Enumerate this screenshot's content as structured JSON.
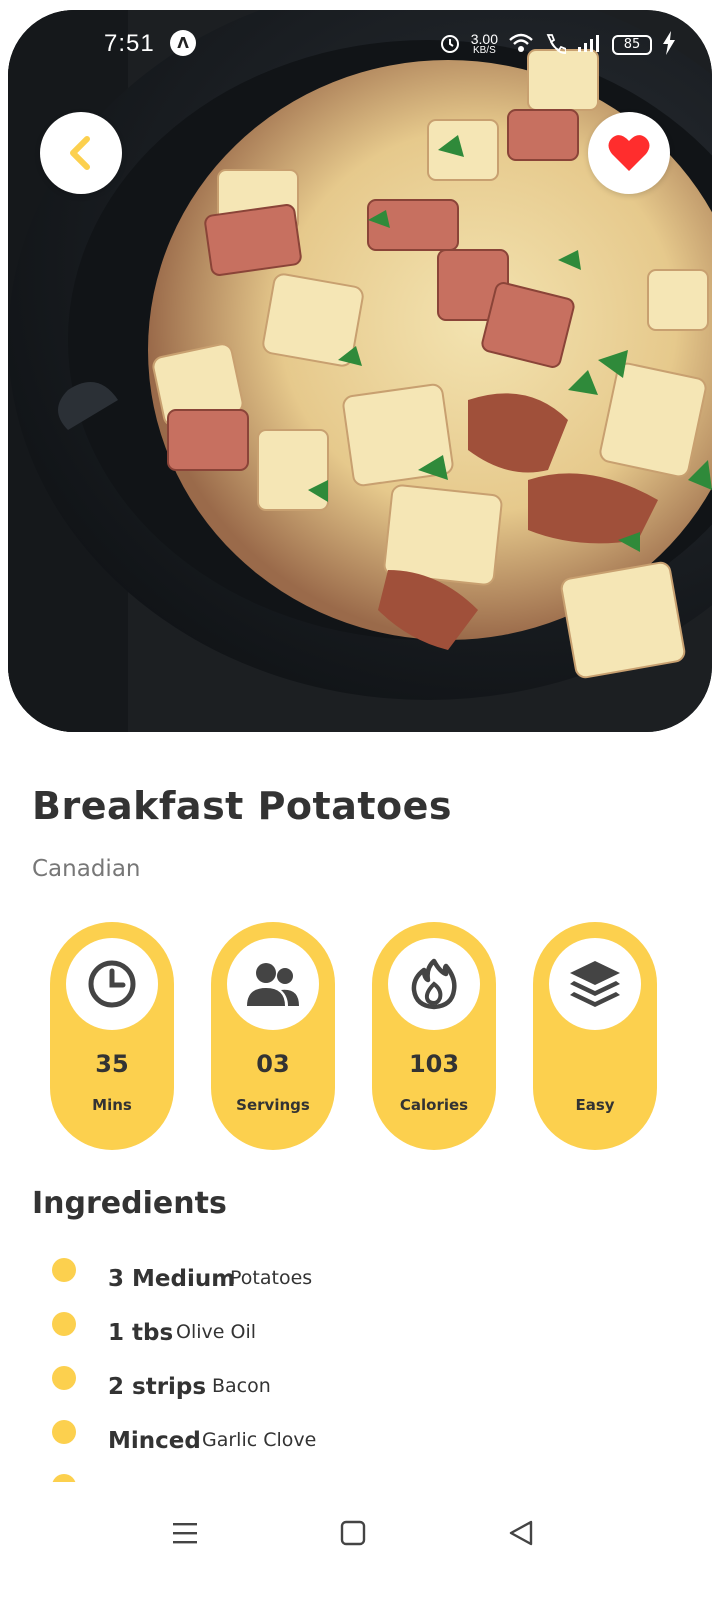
{
  "status_bar": {
    "time": "7:51",
    "speed_value": "3.00",
    "speed_unit": "KB/S",
    "battery": "85"
  },
  "recipe": {
    "title": "Breakfast Potatoes",
    "cuisine": "Canadian",
    "favorite_color": "#ff2d2d",
    "accent_color": "#fcd04e"
  },
  "stats": [
    {
      "icon": "clock-icon",
      "value": "35",
      "label": "Mins"
    },
    {
      "icon": "people-icon",
      "value": "03",
      "label": "Servings"
    },
    {
      "icon": "flame-icon",
      "value": "103",
      "label": "Calories"
    },
    {
      "icon": "layers-icon",
      "value": "",
      "label": "Easy"
    }
  ],
  "ingredients": {
    "heading": "Ingredients",
    "items": [
      {
        "qty": "3 Medium",
        "name": "Potatoes"
      },
      {
        "qty": "1 tbs",
        "name": "Olive Oil"
      },
      {
        "qty": "2 strips",
        "name": "Bacon"
      },
      {
        "qty": "Minced",
        "name": "Garlic Clove"
      }
    ]
  }
}
